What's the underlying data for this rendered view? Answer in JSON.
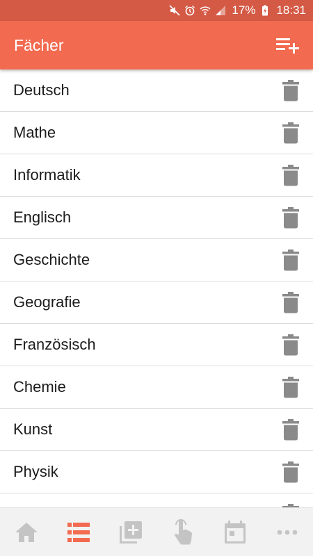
{
  "status_bar": {
    "battery": "17%",
    "time": "18:31",
    "icons": [
      "mute-icon",
      "alarm-icon",
      "wifi-icon",
      "signal-icon",
      "battery-charging-icon"
    ]
  },
  "app_bar": {
    "title": "Fächer",
    "action_icon": "playlist-add-icon"
  },
  "subjects": [
    {
      "name": "Deutsch"
    },
    {
      "name": "Mathe"
    },
    {
      "name": "Informatik"
    },
    {
      "name": "Englisch"
    },
    {
      "name": "Geschichte"
    },
    {
      "name": "Geografie"
    },
    {
      "name": "Französisch"
    },
    {
      "name": "Chemie"
    },
    {
      "name": "Kunst"
    },
    {
      "name": "Physik"
    }
  ],
  "bottom_nav": {
    "items": [
      {
        "icon": "home-icon",
        "active": false
      },
      {
        "icon": "subject-list-icon",
        "active": true
      },
      {
        "icon": "add-library-icon",
        "active": false
      },
      {
        "icon": "touch-icon",
        "active": false
      },
      {
        "icon": "calendar-icon",
        "active": false
      },
      {
        "icon": "more-icon",
        "active": false
      }
    ]
  },
  "colors": {
    "status_bar": "#d45a46",
    "app_bar": "#f26a4f",
    "accent": "#f26a4f",
    "icon_gray": "#8a8a8a",
    "nav_inactive": "#c4c4c4"
  }
}
